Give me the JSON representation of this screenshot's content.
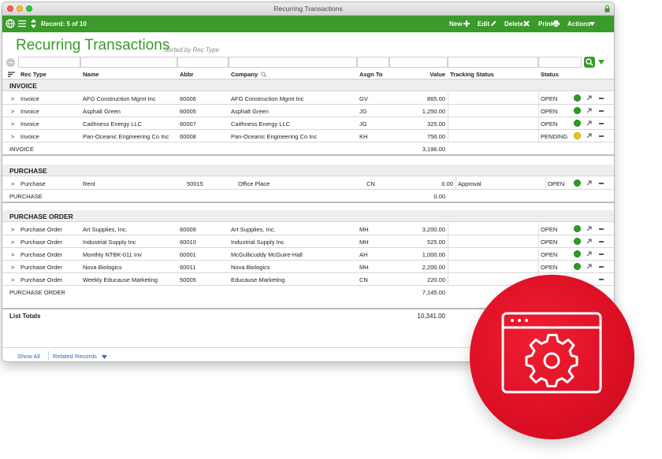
{
  "window": {
    "title": "Recurring Transactions"
  },
  "toolbar": {
    "record": "Record: 5 of 10",
    "new": "New",
    "edit": "Edit",
    "delete": "Delete",
    "print": "Print",
    "actions": "Actions"
  },
  "page": {
    "title": "Recurring Transactions",
    "sorted": "Sorted by Rec Type"
  },
  "columns": [
    "Rec Type",
    "Name",
    "Abbr",
    "Company",
    "Asgn To",
    "Value",
    "Tracking Status",
    "Status"
  ],
  "sections": {
    "invoice": {
      "label": "INVOICE",
      "rows": [
        {
          "type": "Invoice",
          "name": "AFG Construction Mgmt Inc",
          "abbr": "60006",
          "company": "AFG Construction Mgmt Inc",
          "asgn": "GV",
          "value": "865.00",
          "tracking": "",
          "status": "OPEN",
          "dot": "green"
        },
        {
          "type": "Invoice",
          "name": "Asphalt Green",
          "abbr": "60005",
          "company": "Asphalt Green",
          "asgn": "JG",
          "value": "1,250.00",
          "tracking": "",
          "status": "OPEN",
          "dot": "green"
        },
        {
          "type": "Invoice",
          "name": "Caithness Energy LLC",
          "abbr": "60007",
          "company": "Caithness Energy LLC",
          "asgn": "JG",
          "value": "325.00",
          "tracking": "",
          "status": "OPEN",
          "dot": "green"
        },
        {
          "type": "Invoice",
          "name": "Pan-Oceanic Engineering Co Inc",
          "abbr": "60008",
          "company": "Pan-Oceanic Engineering Co Inc",
          "asgn": "KH",
          "value": "756.00",
          "tracking": "",
          "status": "PENDING",
          "dot": "yellow"
        }
      ],
      "subtotal_label": "INVOICE",
      "subtotal_value": "3,196.00"
    },
    "purchase": {
      "label": "PURCHASE",
      "rows": [
        {
          "type": "Purchase",
          "name": "Rent",
          "abbr": "50015",
          "company": "Office Place",
          "asgn": "CN",
          "value": "0.00",
          "tracking": "Approval",
          "status": "OPEN",
          "dot": "green"
        }
      ],
      "subtotal_label": "PURCHASE",
      "subtotal_value": "0.00"
    },
    "purchase_order": {
      "label": "PURCHASE ORDER",
      "rows": [
        {
          "type": "Purchase Order",
          "name": "Art Supplies, Inc.",
          "abbr": "60009",
          "company": "Art Supplies, Inc.",
          "asgn": "MH",
          "value": "3,200.00",
          "tracking": "",
          "status": "OPEN",
          "dot": "green"
        },
        {
          "type": "Purchase Order",
          "name": "Industrial Supply Inc",
          "abbr": "60010",
          "company": "Industrial Supply Inc",
          "asgn": "MH",
          "value": "525.00",
          "tracking": "",
          "status": "OPEN",
          "dot": "green"
        },
        {
          "type": "Purchase Order",
          "name": "Monthly NTBK-011 Inv",
          "abbr": "60001",
          "company": "McGullicuddy McGuire-Hall",
          "asgn": "AH",
          "value": "1,000.00",
          "tracking": "",
          "status": "OPEN",
          "dot": "green"
        },
        {
          "type": "Purchase Order",
          "name": "Nova Biologics",
          "abbr": "60011",
          "company": "Nova Biologics",
          "asgn": "MH",
          "value": "2,200.00",
          "tracking": "",
          "status": "OPEN",
          "dot": "green"
        },
        {
          "type": "Purchase Order",
          "name": "Weekly Educause Marketing",
          "abbr": "50005",
          "company": "Educause Marketing",
          "asgn": "CN",
          "value": "220.00",
          "tracking": "",
          "status": "",
          "dot": ""
        }
      ],
      "subtotal_label": "PURCHASE ORDER",
      "subtotal_value": "7,145.00"
    }
  },
  "totals": {
    "label": "List Totals",
    "value": "10,341.00"
  },
  "footer": {
    "show_all": "Show All",
    "related": "Related Records"
  },
  "colors": {
    "brand_green": "#3a9a2a",
    "badge_red": "#dc0f24",
    "status_green": "#2f9a26",
    "status_yellow": "#f0c40c"
  }
}
